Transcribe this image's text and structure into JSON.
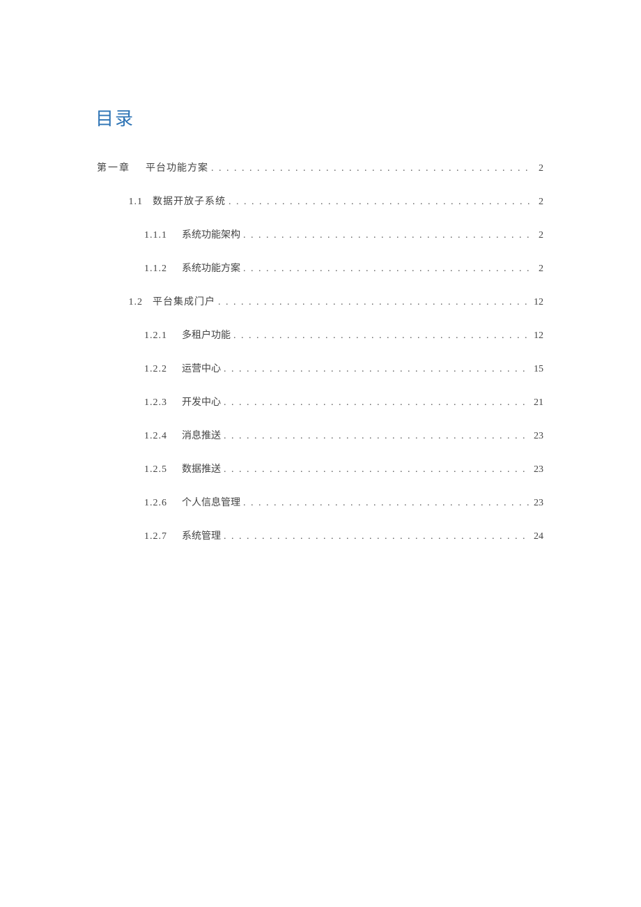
{
  "toc": {
    "heading": "目录",
    "entries": [
      {
        "level": 0,
        "number": "第一章",
        "title": "平台功能方案",
        "page": "2"
      },
      {
        "level": 1,
        "number": "1.1",
        "title": "数据开放子系统",
        "page": "2"
      },
      {
        "level": 2,
        "number": "1.1.1",
        "title": "系统功能架构",
        "page": "2"
      },
      {
        "level": 2,
        "number": "1.1.2",
        "title": "系统功能方案",
        "page": "2"
      },
      {
        "level": 1,
        "number": "1.2",
        "title": "平台集成门户",
        "page": "12"
      },
      {
        "level": 2,
        "number": "1.2.1",
        "title": "多租户功能",
        "page": "12"
      },
      {
        "level": 2,
        "number": "1.2.2",
        "title": "运营中心",
        "page": "15"
      },
      {
        "level": 2,
        "number": "1.2.3",
        "title": "开发中心",
        "page": "21"
      },
      {
        "level": 2,
        "number": "1.2.4",
        "title": "消息推送",
        "page": "23"
      },
      {
        "level": 2,
        "number": "1.2.5",
        "title": "数据推送",
        "page": "23"
      },
      {
        "level": 2,
        "number": "1.2.6",
        "title": "个人信息管理",
        "page": "23"
      },
      {
        "level": 2,
        "number": "1.2.7",
        "title": "系统管理",
        "page": "24"
      }
    ]
  }
}
